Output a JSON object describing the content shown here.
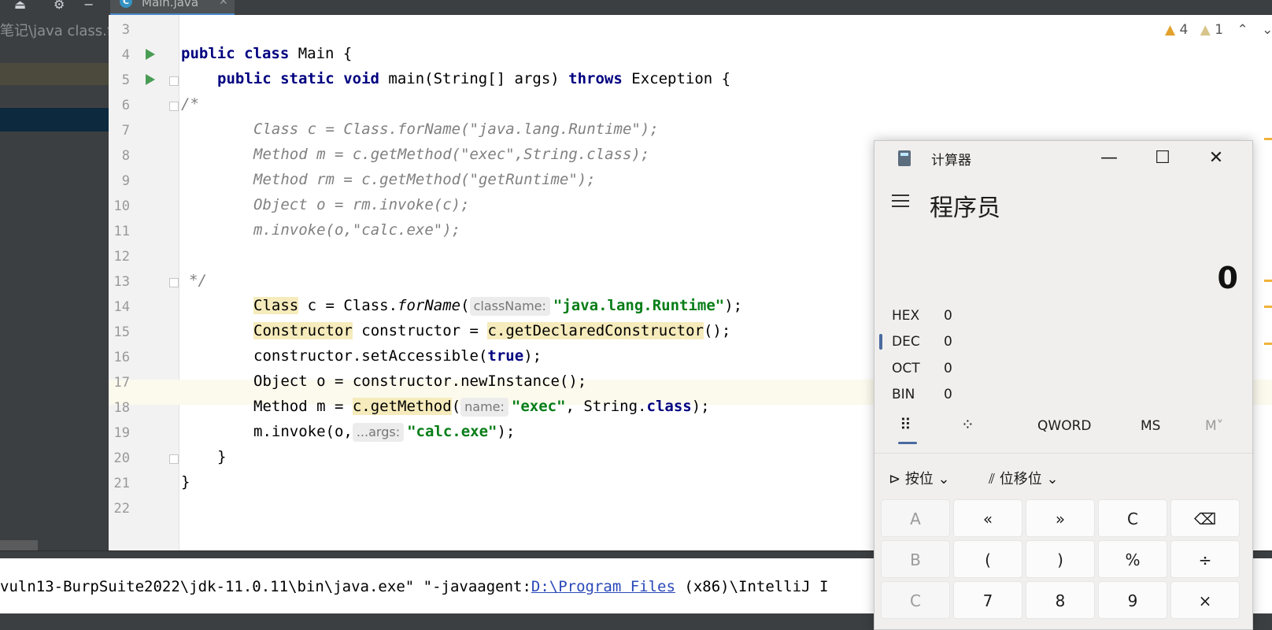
{
  "ide": {
    "tab_name": "Main.java",
    "tab_icon": "C",
    "project_path": "笔记\\java class.fo",
    "inspections": {
      "warnings": "4",
      "weak_warnings": "1"
    },
    "code_hints": {
      "className": "className:",
      "name": "name:",
      "args": "...args:"
    },
    "line_numbers": [
      "3",
      "4",
      "5",
      "6",
      "7",
      "8",
      "9",
      "10",
      "11",
      "12",
      "13",
      "14",
      "15",
      "16",
      "17",
      "18",
      "19",
      "20",
      "21",
      "22"
    ],
    "console": {
      "text_before": "vuln13-BurpSuite2022\\jdk-11.0.11\\bin\\java.exe\" \"-javaagent:",
      "link": "D:\\Program Files",
      "text_after": " (x86)\\IntelliJ I"
    }
  },
  "code_lines": {
    "l4": [
      "public",
      "class",
      " Main {"
    ],
    "l5": [
      "public",
      "static",
      "void",
      " main(String[] args) ",
      "throws",
      " Exception {"
    ],
    "l6": "/*",
    "l7": "Class c = Class.forName(\"java.lang.Runtime\");",
    "l8": "Method m = c.getMethod(\"exec\",String.class);",
    "l9": "Method rm = c.getMethod(\"getRuntime\");",
    "l10": "Object o = rm.invoke(c);",
    "l11": "m.invoke(o,\"calc.exe\");",
    "l13": "*/",
    "l14": [
      "Class",
      " c = Class.",
      "forName",
      "(",
      "\"java.lang.Runtime\"",
      ");"
    ],
    "l15": [
      "Constructor",
      " constructor = ",
      "c.getDeclaredConstructor",
      "();"
    ],
    "l16": [
      "constructor.setAccessible(",
      "true",
      ");"
    ],
    "l17": "Object o = constructor.newInstance();",
    "l18": [
      "Method m = ",
      "c.getMethod",
      "(",
      "\"exec\"",
      ", String.",
      "class",
      ");"
    ],
    "l19": [
      "m.invoke(o,",
      "\"calc.exe\"",
      ");"
    ],
    "l20": "}",
    "l21": "}"
  },
  "calculator": {
    "title": "计算器",
    "mode": "程序员",
    "display": "0",
    "bases": [
      {
        "name": "HEX",
        "value": "0"
      },
      {
        "name": "DEC",
        "value": "0"
      },
      {
        "name": "OCT",
        "value": "0"
      },
      {
        "name": "BIN",
        "value": "0"
      }
    ],
    "word_size": "QWORD",
    "ms": "MS",
    "mdown": "M˅",
    "bitwise": "按位",
    "bitshift": "位移位",
    "keys_row1": [
      "A",
      "«",
      "»",
      "C",
      "⌫"
    ],
    "keys_row2": [
      "B",
      "(",
      ")",
      "%",
      "÷"
    ],
    "keys_row3": [
      "C",
      "7",
      "8",
      "9",
      "×"
    ]
  }
}
